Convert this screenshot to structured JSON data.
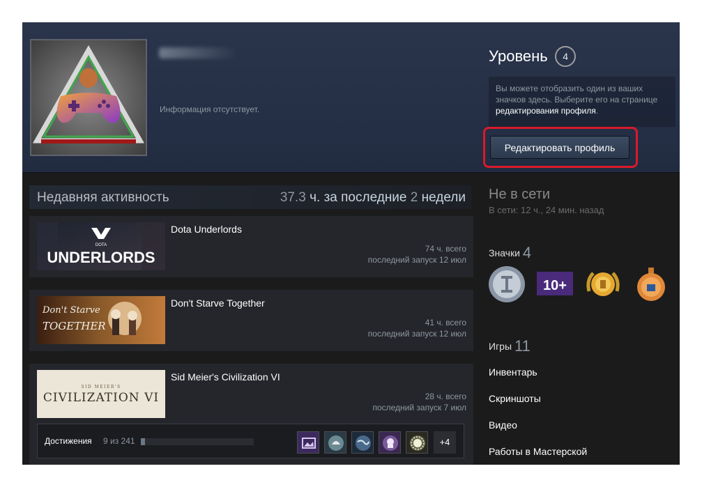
{
  "profile": {
    "summary": "Информация отсутствует.",
    "level_label": "Уровень",
    "level": "4",
    "badge_hint_text": "Вы можете отобразить один из ваших значков здесь. Выберите его на странице ",
    "badge_hint_link": "редактирования профиля",
    "badge_hint_end": ".",
    "edit_button": "Редактировать профиль"
  },
  "activity": {
    "title": "Недавняя активность",
    "hours_num": "37.3",
    "hours_mid": " ч. за последние ",
    "weeks_num": "2",
    "hours_end": " недели",
    "games": [
      {
        "name": "Dota Underlords",
        "hours": "74 ч. всего",
        "last_played": "последний запуск 12 июл",
        "capsule_text": "UNDERLORDS",
        "capsule_sub": "DOTA"
      },
      {
        "name": "Don't Starve Together",
        "hours": "41 ч. всего",
        "last_played": "последний запуск 12 июл",
        "capsule_text": "Don't Starve",
        "capsule_sub": "TOGETHER"
      },
      {
        "name": "Sid Meier's Civilization VI",
        "hours": "28 ч. всего",
        "last_played": "последний запуск 7 июл",
        "capsule_text": "CIVILIZATION VI",
        "capsule_sub": "SID MEIER'S"
      }
    ],
    "achievements": {
      "label": "Достижения",
      "count": "9 из 241",
      "progress": 0.037,
      "more": "+4"
    }
  },
  "sidebar": {
    "status": "Не в сети",
    "status_since": "В сети: 12 ч., 24 мин. назад",
    "badges_label": "Значки",
    "badges_count": "4",
    "badge_10_text": "10+",
    "games_label": "Игры",
    "games_count": "11",
    "links": [
      "Инвентарь",
      "Скриншоты",
      "Видео",
      "Работы в Мастерской"
    ]
  },
  "colors": {
    "accent_red": "#d91a2a",
    "background": "#1b1b1c",
    "header": "#253047"
  }
}
